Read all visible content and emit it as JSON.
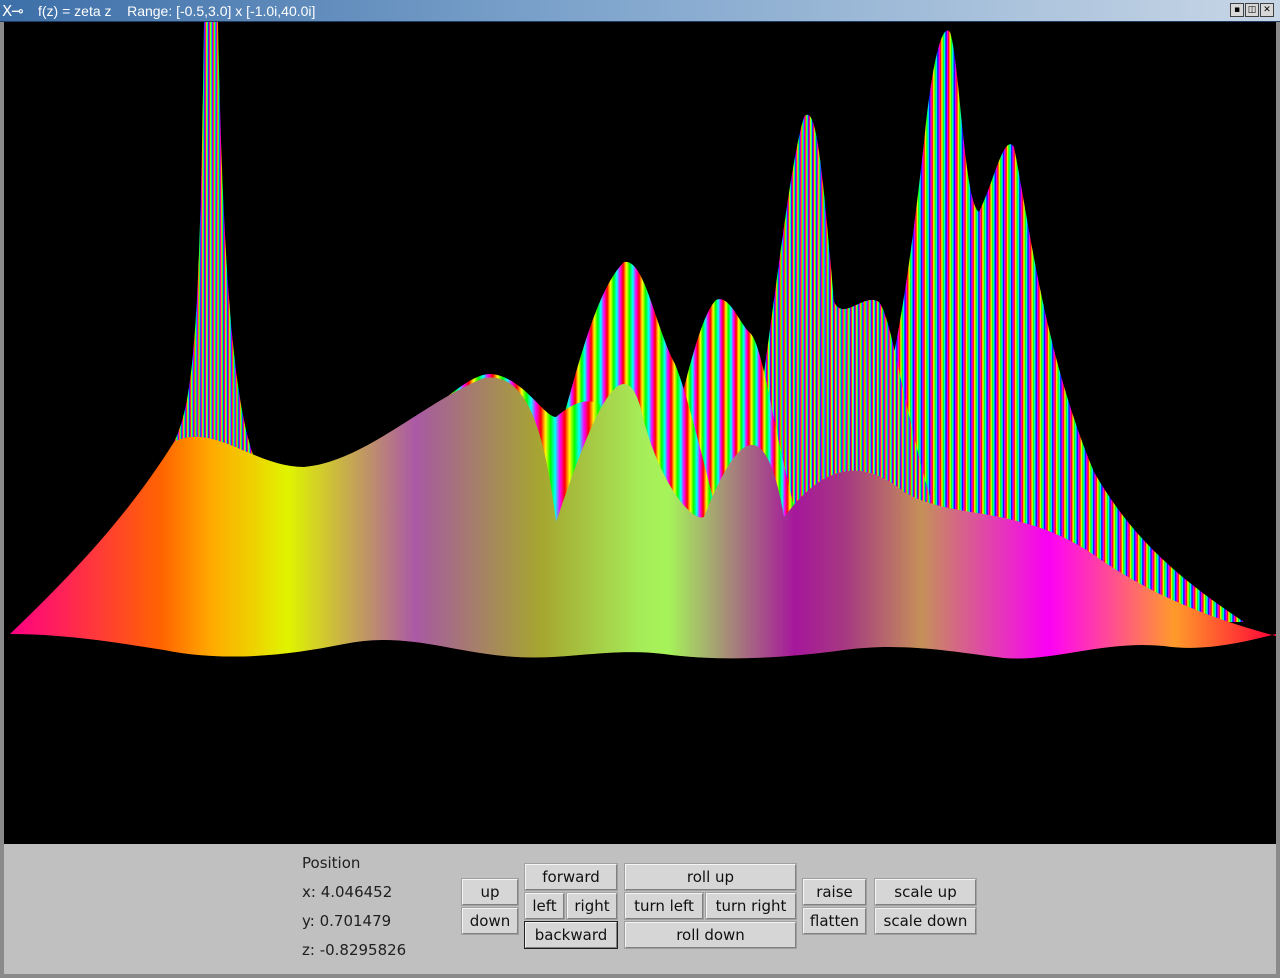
{
  "window": {
    "title": "f(z) = zeta z    Range: [-0.5,3.0] x [-1.0i,40.0i]",
    "controls": [
      "minimize",
      "maximize",
      "close"
    ]
  },
  "position": {
    "heading": "Position",
    "x": "x: 4.046452",
    "y": "y: 0.701479",
    "z": "z: -0.8295826"
  },
  "buttons": {
    "up": "up",
    "down": "down",
    "forward": "forward",
    "left": "left",
    "right": "right",
    "backward": "backward",
    "roll_up": "roll up",
    "turn_left": "turn left",
    "turn_right": "turn right",
    "roll_down": "roll down",
    "raise": "raise",
    "flatten": "flatten",
    "scale_up": "scale up",
    "scale_down": "scale down"
  },
  "colors": {
    "background": "#000000",
    "panel": "#c0c0c0",
    "title_gradient_start": "#3d6fa8"
  }
}
